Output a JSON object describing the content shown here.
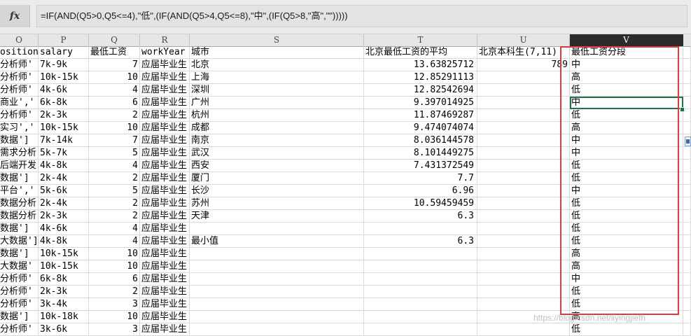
{
  "formula_bar": {
    "fx_label": "fx",
    "formula": "=IF(AND(Q5>0,Q5<=4),\"低\",(IF(AND(Q5>4,Q5<=8),\"中\",(IF(Q5>8,\"高\",\"\")))))"
  },
  "columns": [
    "O",
    "P",
    "Q",
    "R",
    "S",
    "T",
    "U",
    "V"
  ],
  "selected_column": "V",
  "rows": [
    {
      "O": "ositionl",
      "P": "salary",
      "Q": "最低工资",
      "R": "workYear",
      "S": "城市",
      "T": "北京最低工资的平均",
      "U": "北京本科生(7,11)",
      "V": "最低工资分段"
    },
    {
      "O": "分析师'",
      "P": "7k-9k",
      "Q": "7",
      "R": "应届毕业生",
      "S": "北京",
      "T": "13.63825712",
      "U": "789",
      "V": "中"
    },
    {
      "O": "分析师'",
      "P": "10k-15k",
      "Q": "10",
      "R": "应届毕业生",
      "S": "上海",
      "T": "12.85291113",
      "U": "",
      "V": "高"
    },
    {
      "O": "分析师'",
      "P": "4k-6k",
      "Q": "4",
      "R": "应届毕业生",
      "S": "深圳",
      "T": "12.82542694",
      "U": "",
      "V": "低"
    },
    {
      "O": "商业','",
      "P": "6k-8k",
      "Q": "6",
      "R": "应届毕业生",
      "S": "广州",
      "T": "9.397014925",
      "U": "",
      "V": "中"
    },
    {
      "O": "分析师'",
      "P": "2k-3k",
      "Q": "2",
      "R": "应届毕业生",
      "S": "杭州",
      "T": "11.87469287",
      "U": "",
      "V": "低"
    },
    {
      "O": "实习','",
      "P": "10k-15k",
      "Q": "10",
      "R": "应届毕业生",
      "S": "成都",
      "T": "9.474074074",
      "U": "",
      "V": "高"
    },
    {
      "O": "数据']",
      "P": "7k-14k",
      "Q": "7",
      "R": "应届毕业生",
      "S": "南京",
      "T": "8.036144578",
      "U": "",
      "V": "中"
    },
    {
      "O": "需求分析",
      "P": "5k-7k",
      "Q": "5",
      "R": "应届毕业生",
      "S": "武汉",
      "T": "8.101449275",
      "U": "",
      "V": "中"
    },
    {
      "O": "后端开发",
      "P": "4k-8k",
      "Q": "4",
      "R": "应届毕业生",
      "S": "西安",
      "T": "7.431372549",
      "U": "",
      "V": "低"
    },
    {
      "O": "数据']",
      "P": "2k-4k",
      "Q": "2",
      "R": "应届毕业生",
      "S": "厦门",
      "T": "7.7",
      "U": "",
      "V": "低"
    },
    {
      "O": "平台','",
      "P": "5k-6k",
      "Q": "5",
      "R": "应届毕业生",
      "S": "长沙",
      "T": "6.96",
      "U": "",
      "V": "中"
    },
    {
      "O": "数据分析",
      "P": "2k-4k",
      "Q": "2",
      "R": "应届毕业生",
      "S": "苏州",
      "T": "10.59459459",
      "U": "",
      "V": "低"
    },
    {
      "O": "数据分析",
      "P": "2k-3k",
      "Q": "2",
      "R": "应届毕业生",
      "S": "天津",
      "T": "6.3",
      "U": "",
      "V": "低"
    },
    {
      "O": "数据']",
      "P": "4k-6k",
      "Q": "4",
      "R": "应届毕业生",
      "S": "",
      "T": "",
      "U": "",
      "V": "低"
    },
    {
      "O": "大数据']",
      "P": "4k-8k",
      "Q": "4",
      "R": "应届毕业生",
      "S": "最小值",
      "T": "6.3",
      "U": "",
      "V": "低"
    },
    {
      "O": "数据']",
      "P": "10k-15k",
      "Q": "10",
      "R": "应届毕业生",
      "S": "",
      "T": "",
      "U": "",
      "V": "高"
    },
    {
      "O": "大数据'",
      "P": "10k-15k",
      "Q": "10",
      "R": "应届毕业生",
      "S": "",
      "T": "",
      "U": "",
      "V": "高"
    },
    {
      "O": "分析师'",
      "P": "6k-8k",
      "Q": "6",
      "R": "应届毕业生",
      "S": "",
      "T": "",
      "U": "",
      "V": "中"
    },
    {
      "O": "分析师'",
      "P": "2k-3k",
      "Q": "2",
      "R": "应届毕业生",
      "S": "",
      "T": "",
      "U": "",
      "V": "低"
    },
    {
      "O": "分析师'",
      "P": "3k-4k",
      "Q": "3",
      "R": "应届毕业生",
      "S": "",
      "T": "",
      "U": "",
      "V": "低"
    },
    {
      "O": "数据']",
      "P": "10k-18k",
      "Q": "10",
      "R": "应届毕业生",
      "S": "",
      "T": "",
      "U": "",
      "V": "高"
    },
    {
      "O": "分析师'",
      "P": "3k-6k",
      "Q": "3",
      "R": "应届毕业生",
      "S": "",
      "T": "",
      "U": "",
      "V": "低"
    }
  ],
  "watermark": "https://blog.csdn.net/liyingjiefh",
  "colors": {
    "highlight_box": "#e0393e",
    "active_cell": "#217346",
    "selected_header": "#2b2b2b"
  }
}
